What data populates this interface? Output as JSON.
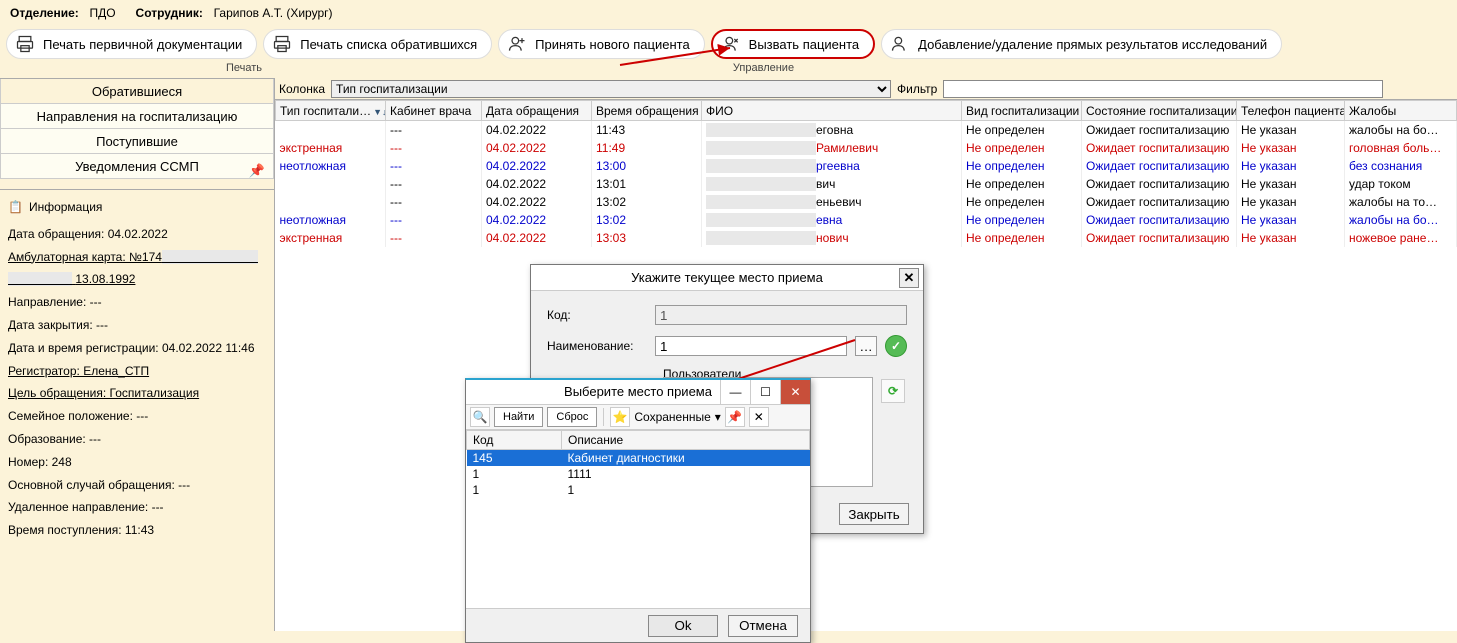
{
  "header": {
    "dept_label": "Отделение:",
    "dept_value": "ПДО",
    "emp_label": "Сотрудник:",
    "emp_value": "Гарипов А.Т. (Хирург)"
  },
  "toolbar": {
    "btn1": "Печать первичной документации",
    "btn2": "Печать списка обратившихся",
    "btn3": "Принять нового пациента",
    "btn4": "Вызвать пациента",
    "btn5": "Добавление/удаление прямых результатов исследований",
    "section_print": "Печать",
    "section_mgmt": "Управление"
  },
  "tabs": {
    "t1": "Обратившиеся",
    "t2": "Направления на госпитализацию",
    "t3": "Поступившие",
    "t4": "Уведомления ССМП"
  },
  "info": {
    "title": "Информация",
    "r1": "Дата обращения: 04.02.2022",
    "r2a": "Амбулаторная карта: №174",
    "r2b": "13.08.1992",
    "r3": "Направление: ---",
    "r4": "Дата закрытия: ---",
    "r5": "Дата и время регистрации: 04.02.2022 11:46",
    "r6": "Регистратор: Елена_СТП",
    "r7": "Цель обращения: Госпитализация",
    "r8": "Семейное положение: ---",
    "r9": "Образование: ---",
    "r10": "Номер: 248",
    "r11": "Основной случай обращения: ---",
    "r12": "Удаленное направление: ---",
    "r13": "Время поступления: 11:43"
  },
  "filter": {
    "col_label": "Колонка",
    "col_value": "Тип госпитализации",
    "flt_label": "Фильтр"
  },
  "columns": {
    "c1": "Тип госпитали…",
    "c2": "Кабинет врача",
    "c3": "Дата обращения",
    "c4": "Время обращения",
    "c5": "ФИО",
    "c6": "Вид госпитализации",
    "c7": "Состояние госпитализации",
    "c8": "Телефон пациента",
    "c9": "Жалобы"
  },
  "rows": [
    {
      "cls": "row-black",
      "c1": "",
      "c2": "---",
      "c3": "04.02.2022",
      "c4": "11:43",
      "c5": "еговна",
      "c6": "Не определен",
      "c7": "Ожидает госпитализацию",
      "c8": "Не указан",
      "c9": "жалобы на бо…"
    },
    {
      "cls": "row-red",
      "c1": "экстренная",
      "c2": "---",
      "c3": "04.02.2022",
      "c4": "11:49",
      "c5": "Рамилевич",
      "c6": "Не определен",
      "c7": "Ожидает госпитализацию",
      "c8": "Не указан",
      "c9": "головная боль…"
    },
    {
      "cls": "row-blue",
      "c1": "неотложная",
      "c2": "---",
      "c3": "04.02.2022",
      "c4": "13:00",
      "c5": "ргеевна",
      "c6": "Не определен",
      "c7": "Ожидает госпитализацию",
      "c8": "Не указан",
      "c9": "без сознания"
    },
    {
      "cls": "row-black",
      "c1": "",
      "c2": "---",
      "c3": "04.02.2022",
      "c4": "13:01",
      "c5": "вич",
      "c6": "Не определен",
      "c7": "Ожидает госпитализацию",
      "c8": "Не указан",
      "c9": "удар током"
    },
    {
      "cls": "row-black",
      "c1": "",
      "c2": "---",
      "c3": "04.02.2022",
      "c4": "13:02",
      "c5": "еньевич",
      "c6": "Не определен",
      "c7": "Ожидает госпитализацию",
      "c8": "Не указан",
      "c9": "жалобы на то…"
    },
    {
      "cls": "row-blue",
      "c1": "неотложная",
      "c2": "---",
      "c3": "04.02.2022",
      "c4": "13:02",
      "c5": "евна",
      "c6": "Не определен",
      "c7": "Ожидает госпитализацию",
      "c8": "Не указан",
      "c9": "жалобы на бо…"
    },
    {
      "cls": "row-red",
      "c1": "экстренная",
      "c2": "---",
      "c3": "04.02.2022",
      "c4": "13:03",
      "c5": "нович",
      "c6": "Не определен",
      "c7": "Ожидает госпитализацию",
      "c8": "Не указан",
      "c9": "ножевое ране…"
    }
  ],
  "modal1": {
    "title": "Укажите текущее место приема",
    "code_label": "Код:",
    "code_value": "1",
    "name_label": "Наименование:",
    "name_value": "1",
    "users_label": "Пользователи",
    "close_btn": "Закрыть"
  },
  "modal2": {
    "title": "Выберите место приема",
    "find": "Найти",
    "reset": "Сброс",
    "saved": "Сохраненные",
    "col_code": "Код",
    "col_desc": "Описание",
    "rows": [
      {
        "code": "145",
        "desc": "Кабинет диагностики",
        "sel": true
      },
      {
        "code": "1",
        "desc": "1111",
        "sel": false
      },
      {
        "code": "1",
        "desc": "1",
        "sel": false
      }
    ],
    "ok": "Ok",
    "cancel": "Отмена"
  }
}
